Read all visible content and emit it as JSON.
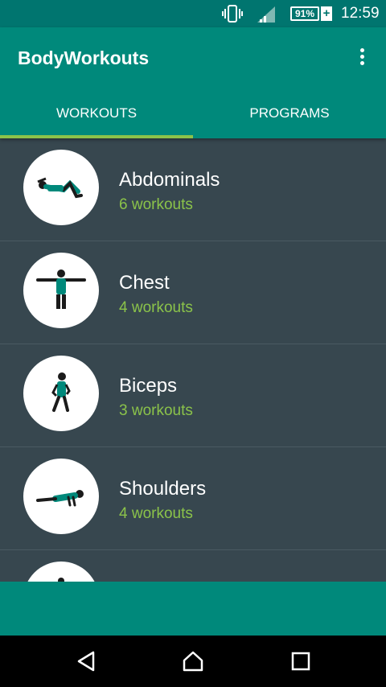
{
  "status_bar": {
    "battery": "91%",
    "battery_plus": "+",
    "time": "12:59",
    "icons": [
      "vibrate-icon",
      "signal-icon",
      "battery-icon"
    ]
  },
  "app_bar": {
    "title": "BodyWorkouts",
    "menu_icon": "overflow-menu-icon"
  },
  "tabs": [
    {
      "label": "WORKOUTS",
      "selected": true
    },
    {
      "label": "PROGRAMS",
      "selected": false
    }
  ],
  "workouts": [
    {
      "name": "Abdominals",
      "count": "6 workouts",
      "icon": "abdominals-exercise-icon"
    },
    {
      "name": "Chest",
      "count": "4 workouts",
      "icon": "chest-exercise-icon"
    },
    {
      "name": "Biceps",
      "count": "3 workouts",
      "icon": "biceps-exercise-icon"
    },
    {
      "name": "Shoulders",
      "count": "4 workouts",
      "icon": "shoulders-exercise-icon"
    },
    {
      "name": "",
      "count": "",
      "icon": "exercise-icon"
    }
  ],
  "nav_bar": {
    "icons": [
      "back-icon",
      "home-icon",
      "recent-apps-icon"
    ]
  },
  "colors": {
    "status_bar": "#00756f",
    "primary": "#00897b",
    "accent": "#8bc34a",
    "list_background": "#37474f"
  }
}
